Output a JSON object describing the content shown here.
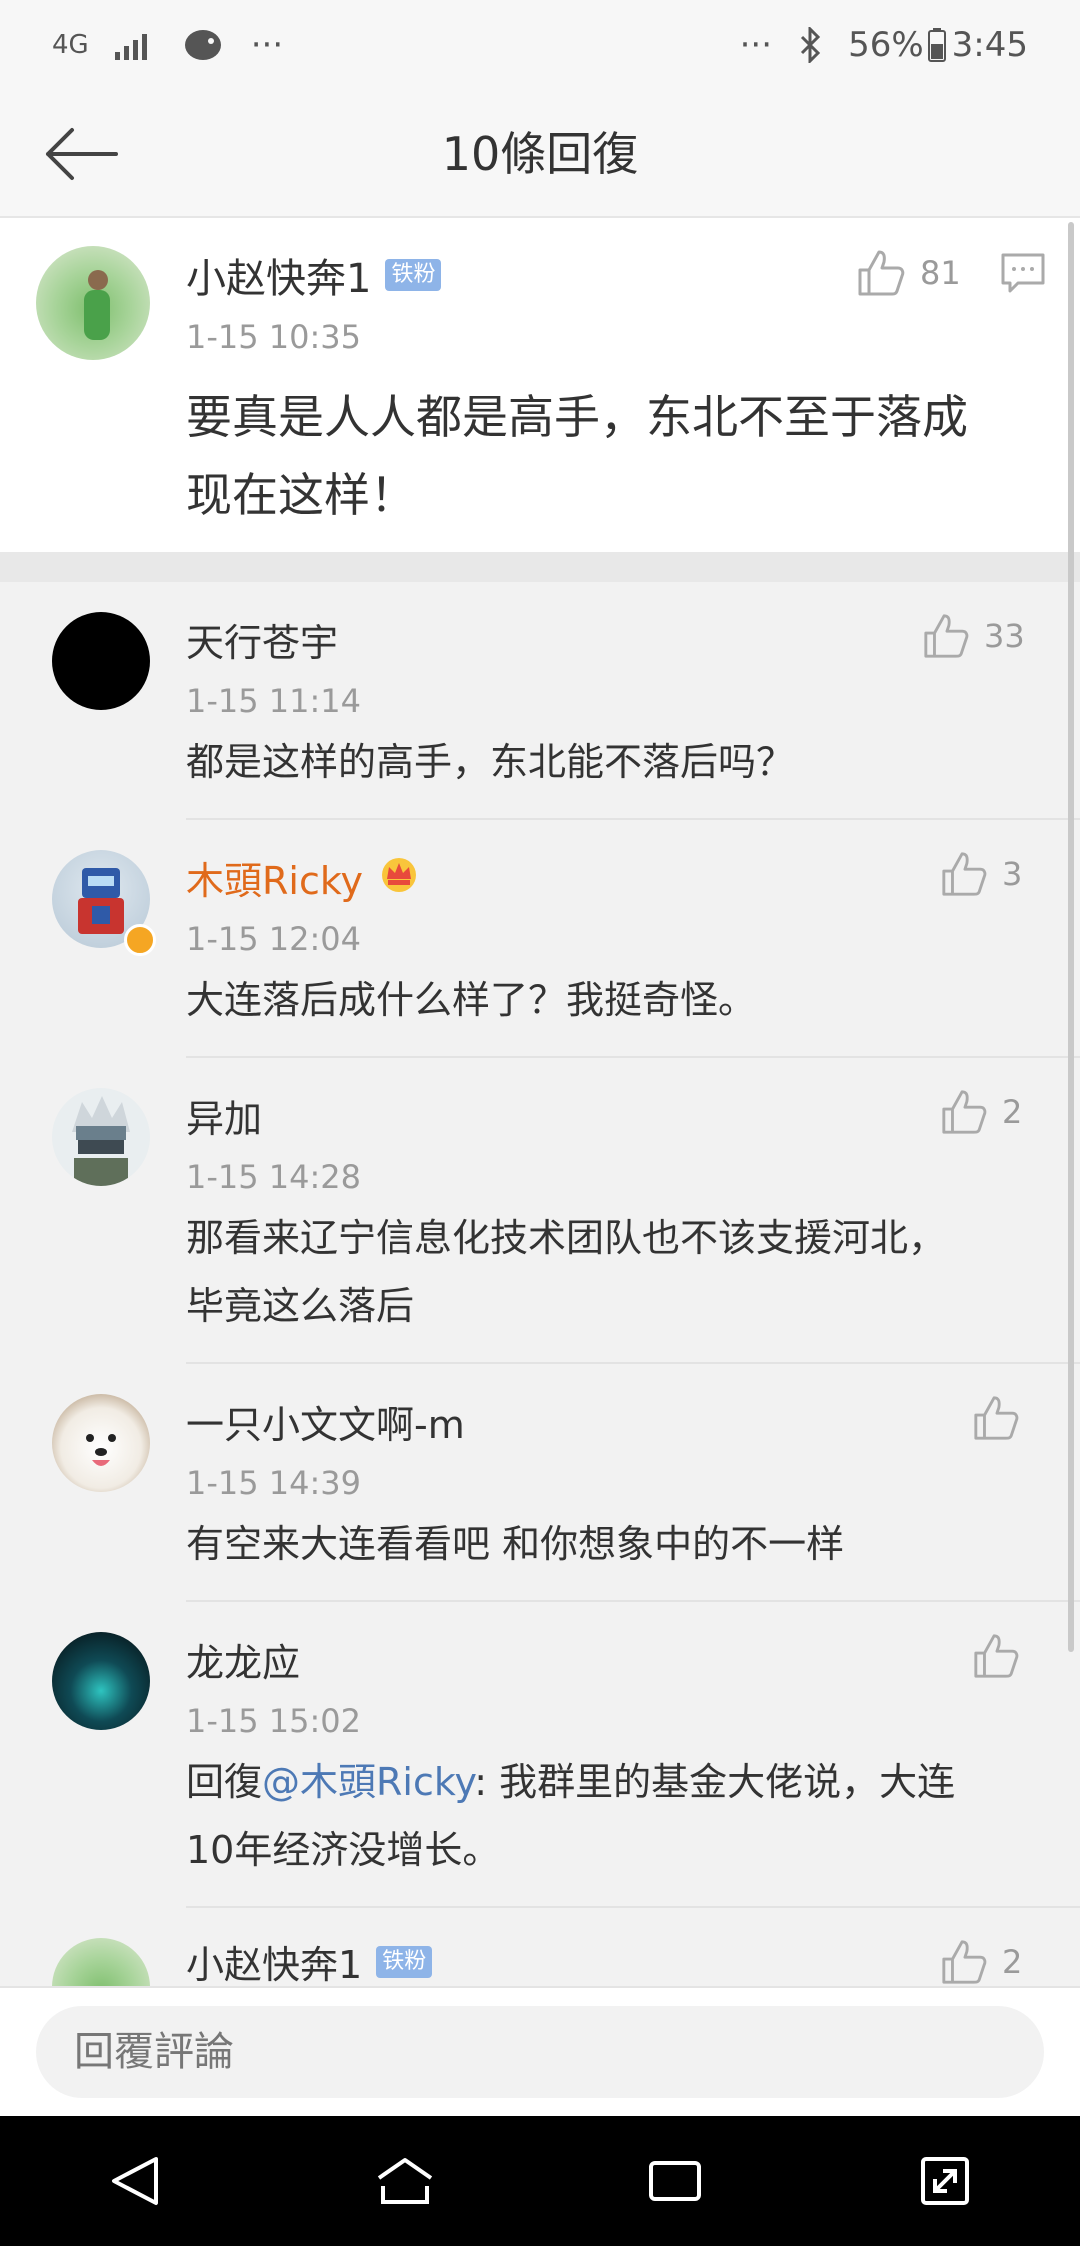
{
  "status_bar": {
    "network": "4G",
    "more_left": "···",
    "more_right": "···",
    "battery": "56%",
    "time": "3:45"
  },
  "header": {
    "title": "10條回復"
  },
  "main_comment": {
    "user": "小赵快奔1",
    "badge": "铁粉",
    "time": "1-15 10:35",
    "likes": "81",
    "text_line1": "要真是人人都是高手，东北不至于落成",
    "text_line2": "现在这样！"
  },
  "replies": [
    {
      "user": "天行苍宇",
      "time": "1-15 11:14",
      "likes": "33",
      "text": "都是这样的高手，东北能不落后吗？"
    },
    {
      "user": "木頭Ricky",
      "time": "1-15 12:04",
      "likes": "3",
      "text": "大连落后成什么样了？我挺奇怪。"
    },
    {
      "user": "异加",
      "time": "1-15 14:28",
      "likes": "2",
      "text_line1": "那看来辽宁信息化技术团队也不该支援河北，",
      "text_line2": "毕竟这么落后"
    },
    {
      "user": "一只小文文啊-m",
      "time": "1-15 14:39",
      "likes": "",
      "text": "有空来大连看看吧 和你想象中的不一样"
    },
    {
      "user": "龙龙应",
      "time": "1-15 15:02",
      "likes": "",
      "reply_prefix": "回復",
      "mention": "@木頭Ricky",
      "text_rest": ": 我群里的基金大佬说，大连",
      "text_line2": "10年经济没增长。"
    },
    {
      "user": "小赵快奔1",
      "badge": "铁粉",
      "likes": "2"
    }
  ],
  "input": {
    "placeholder": "回覆評論"
  },
  "colors": {
    "accent_orange": "#e06a1b",
    "mention_blue": "#4d79b5",
    "badge_blue": "#8eb4e8"
  }
}
